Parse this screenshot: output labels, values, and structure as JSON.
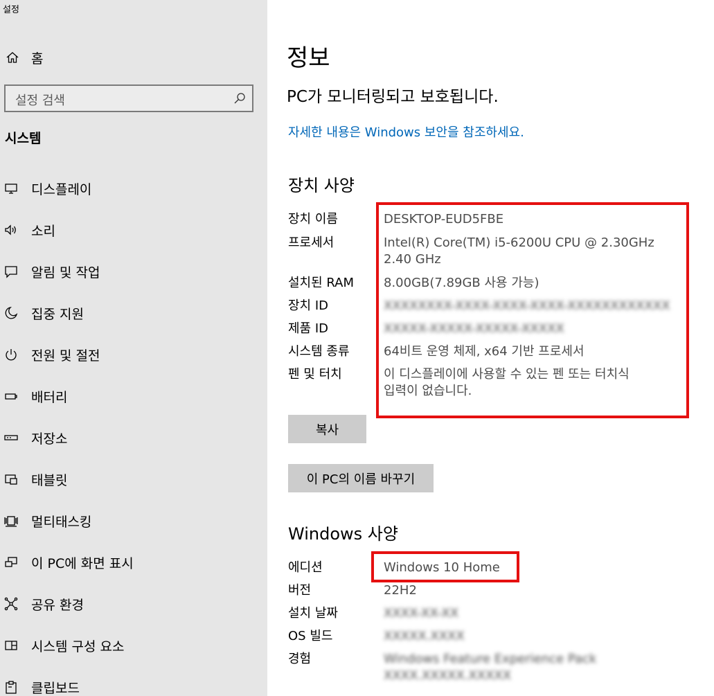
{
  "app": {
    "title": "설정"
  },
  "sidebar": {
    "home_label": "홈",
    "search_placeholder": "설정 검색",
    "section_label": "시스템",
    "items": [
      {
        "label": "디스플레이",
        "icon": "monitor-icon"
      },
      {
        "label": "소리",
        "icon": "speaker-icon"
      },
      {
        "label": "알림 및 작업",
        "icon": "notification-icon"
      },
      {
        "label": "집중 지원",
        "icon": "moon-icon"
      },
      {
        "label": "전원 및 절전",
        "icon": "power-icon"
      },
      {
        "label": "배터리",
        "icon": "battery-icon"
      },
      {
        "label": "저장소",
        "icon": "storage-icon"
      },
      {
        "label": "태블릿",
        "icon": "tablet-icon"
      },
      {
        "label": "멀티태스킹",
        "icon": "multitasking-icon"
      },
      {
        "label": "이 PC에 화면 표시",
        "icon": "project-icon"
      },
      {
        "label": "공유 환경",
        "icon": "share-icon"
      },
      {
        "label": "시스템 구성 요소",
        "icon": "components-icon"
      },
      {
        "label": "클립보드",
        "icon": "clipboard-icon"
      }
    ]
  },
  "main": {
    "title": "정보",
    "status": "PC가 모니터링되고 보호됩니다.",
    "security_link": "자세한 내용은 Windows 보안을 참조하세요.",
    "device_specs": {
      "heading": "장치 사양",
      "rows": [
        {
          "label": "장치 이름",
          "value": "DESKTOP-EUD5FBE"
        },
        {
          "label": "프로세서",
          "value": "Intel(R) Core(TM) i5-6200U CPU @ 2.30GHz",
          "value2": "2.40 GHz"
        },
        {
          "label": "설치된 RAM",
          "value": "8.00GB(7.89GB 사용 가능)"
        },
        {
          "label": "장치 ID",
          "value": "XXXXXXXX-XXXX-XXXX-XXXX-XXXXXXXXXXXX"
        },
        {
          "label": "제품 ID",
          "value": "XXXXX-XXXXX-XXXXX-XXXXX"
        },
        {
          "label": "시스템 종류",
          "value": "64비트 운영 체제, x64 기반 프로세서"
        },
        {
          "label": "펜 및 터치",
          "value": "이 디스플레이에 사용할 수 있는 펜 또는 터치식",
          "value2": "입력이 없습니다."
        }
      ],
      "copy_button": "복사",
      "rename_button": "이 PC의 이름 바꾸기"
    },
    "windows_specs": {
      "heading": "Windows 사양",
      "rows": [
        {
          "label": "에디션",
          "value": "Windows 10 Home"
        },
        {
          "label": "버전",
          "value": "22H2"
        },
        {
          "label": "설치 날짜",
          "value": "XXXX-XX-XX"
        },
        {
          "label": "OS 빌드",
          "value": "XXXXX.XXXX"
        },
        {
          "label": "경험",
          "value": "Windows Feature Experience Pack",
          "value2": "XXXX.XXXXX.XXXXX"
        }
      ]
    },
    "highlight_color": "#e51010",
    "link_color": "#0067b8"
  }
}
